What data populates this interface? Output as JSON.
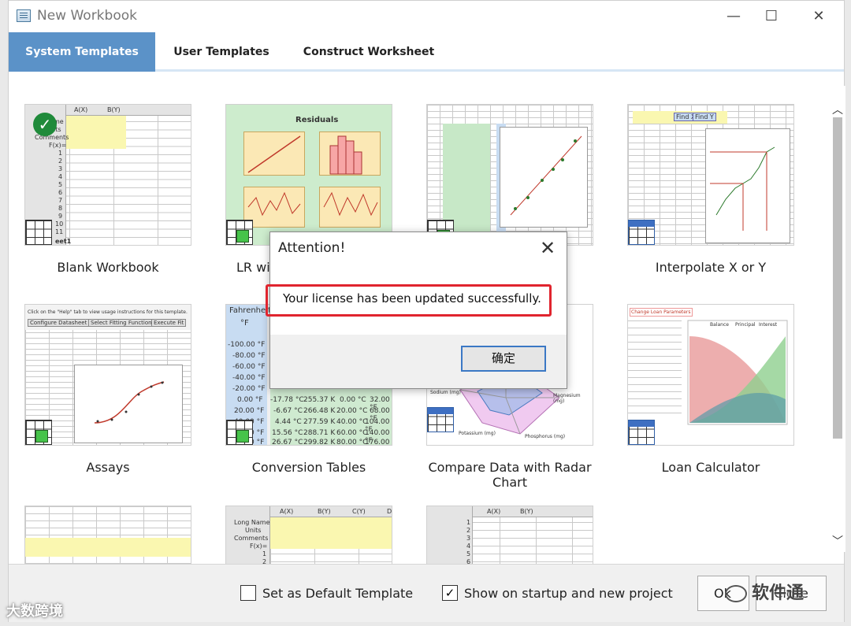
{
  "window": {
    "title": "New Workbook",
    "minimize_icon": "minimize-icon",
    "maximize_icon": "maximize-icon",
    "close_icon": "close-icon"
  },
  "tabs": [
    {
      "label": "System Templates",
      "active": true
    },
    {
      "label": "User Templates",
      "active": false
    },
    {
      "label": "Construct Worksheet",
      "active": false
    }
  ],
  "templates": [
    {
      "label": "Blank Workbook",
      "selected": true
    },
    {
      "label": "LR wit"
    },
    {
      "label": ""
    },
    {
      "label": "Interpolate X or Y"
    },
    {
      "label": "Assays"
    },
    {
      "label": "Conversion Tables"
    },
    {
      "label": "Compare Data with Radar Chart"
    },
    {
      "label": "Loan Calculator"
    },
    {
      "label": ""
    },
    {
      "label": ""
    },
    {
      "label": ""
    }
  ],
  "thumb_text": {
    "blank": {
      "cols": [
        "A(X)",
        "B(Y)"
      ],
      "rows": [
        "me",
        "its",
        "Comments",
        "F(x)=",
        "1",
        "2",
        "3",
        "4",
        "5",
        "6",
        "7",
        "8",
        "9",
        "10",
        "11"
      ],
      "sheet": "eet1"
    },
    "residuals": {
      "title": "Residuals"
    },
    "interp": {
      "buttons": [
        "Find X",
        "Find Y"
      ]
    },
    "assays": {
      "header": "Click on the \"Help\" tab to view usage instructions for this template.",
      "buttons": [
        "Configure Datasheet",
        "Select Fitting Function",
        "Execute Fit"
      ]
    },
    "conversion": {
      "header": "Fahrenheit",
      "unit": "°F",
      "col_f": [
        "-100.00 °F",
        "-80.00 °F",
        "-60.00 °F",
        "-40.00 °F",
        "-20.00 °F",
        "0.00 °F",
        "20.00 °F",
        "40.00 °F",
        "60.00 °F",
        "80.00 °F"
      ],
      "col_c": [
        "-17.78 °C",
        "-6.67 °C",
        "4.44 °C",
        "15.56 °C",
        "26.67 °C"
      ],
      "col_k": [
        "255.37 K",
        "266.48 K",
        "277.59 K",
        "288.71 K",
        "299.82 K"
      ],
      "col_c2": [
        "0.00 °C",
        "20.00 °C",
        "40.00 °C",
        "60.00 °C",
        "80.00 °C"
      ],
      "col_f2": [
        "32.00 °F",
        "68.00 °F",
        "104.00 °F",
        "140.00 °F",
        "176.00 °F"
      ]
    },
    "radar": {
      "labels": [
        "Sodium (mg)",
        "Magnesium (mg)",
        "Potassium (mg)",
        "Phosphorus (mg)"
      ]
    },
    "loan": {
      "button": "Change Loan Parameters",
      "legend": [
        "Balance",
        "Principal",
        "Interest"
      ]
    },
    "blank2": {
      "cols": [
        "A(X)",
        "B(Y)",
        "C(Y)",
        "D"
      ],
      "rows": [
        "Long Name",
        "Units",
        "Comments",
        "F(x)=",
        "1",
        "2"
      ]
    },
    "blank3": {
      "cols": [
        "A(X)",
        "B(Y)"
      ],
      "rows": [
        "1",
        "2",
        "3",
        "4",
        "5",
        "6"
      ]
    }
  },
  "bottom": {
    "default_template_label": "Set as Default Template",
    "default_template_checked": false,
    "show_startup_label": "Show on startup and new project",
    "show_startup_checked": true,
    "ok_label": "Ok",
    "close_label": "Close"
  },
  "dialog": {
    "title": "Attention!",
    "message": "Your license has been updated successfully.",
    "ok_label": "确定",
    "highlight_color": "#e0242e"
  },
  "watermarks": {
    "brand_right": "软件通",
    "brand_left": "大数跨境"
  },
  "colors": {
    "accent_tab": "#5b92c8",
    "dialog_button_border": "#3b78c5"
  }
}
